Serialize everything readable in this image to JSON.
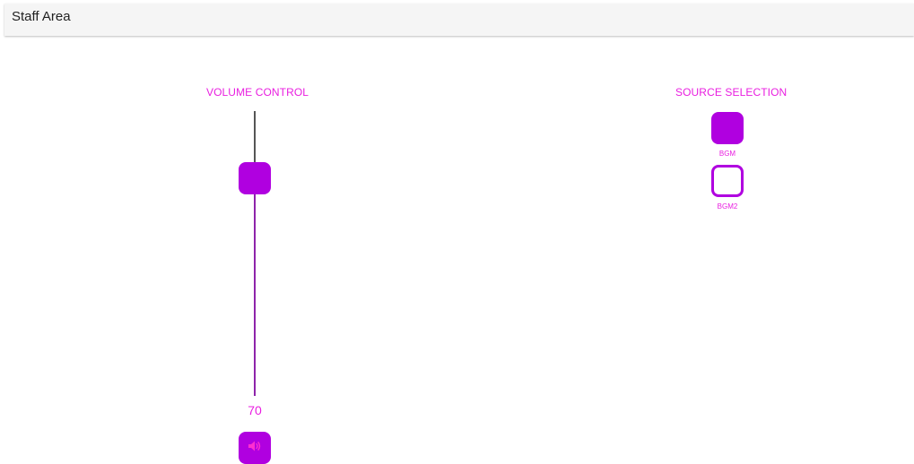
{
  "app_bar": {
    "title": "Staff Area"
  },
  "volume_control": {
    "label": "VOLUME CONTROL",
    "value": 70,
    "value_text": "70",
    "min": 0,
    "max": 100,
    "mute_icon": "speaker-icon"
  },
  "source_selection": {
    "label": "SOURCE SELECTION",
    "sources": [
      {
        "label": "BGM",
        "selected": true
      },
      {
        "label": "BGM2",
        "selected": false
      }
    ]
  },
  "colors": {
    "accent": "#b000e0",
    "label_text": "#e91ee0",
    "track_upper": "#555555",
    "track_lower": "#8e24aa",
    "app_bar_bg": "#f5f5f5"
  }
}
